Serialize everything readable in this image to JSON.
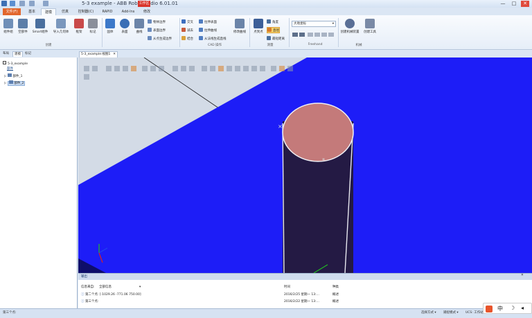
{
  "window": {
    "title": "5-3 example - ABB RobotStudio 6.01.01",
    "context_tab": "工作区",
    "controls": [
      "—",
      "□",
      "✕"
    ]
  },
  "tabs": [
    "文件(F)",
    "基本",
    "建模",
    "仿真",
    "控制器(C)",
    "RAPID",
    "Add-Ins",
    "修改"
  ],
  "ribbon": {
    "groups": [
      {
        "label": "创建",
        "large": [
          "组件组",
          "空部件",
          "Smart组件",
          "导入几何体",
          "框架",
          "标记"
        ]
      },
      {
        "label": "",
        "large": [
          "固体",
          "表面",
          "曲线"
        ],
        "small": [
          "物体边界",
          "表面边界",
          "从点生成边界"
        ]
      },
      {
        "label": "CAD 操作",
        "small": [
          "交叉",
          "减去",
          "结合",
          "拉伸表面",
          "拉伸曲线",
          "从法线生成直线"
        ],
        "large": [
          "修改曲线"
        ]
      },
      {
        "label": "测量",
        "large": [
          "点到点"
        ],
        "small": [
          "角度",
          "直径",
          "最短距离"
        ]
      },
      {
        "label": "Freehand",
        "select": "大地坐标"
      },
      {
        "label": "机械",
        "large": [
          "创建机械装置",
          "创建工具"
        ]
      }
    ]
  },
  "left_panel": {
    "tabs": [
      "布局",
      "建模",
      "标记"
    ],
    "section_label": "部件",
    "tree": {
      "station": "5-3_example",
      "items": [
        "部件_1",
        "部件_2"
      ]
    }
  },
  "viewport": {
    "tab_label": "5-3_example:视图1",
    "colors": {
      "floor": "#1d1df7",
      "bg": "#d3dbe6",
      "cylinder_body": "#241a44",
      "cylinder_top": "#c47a7a"
    }
  },
  "output": {
    "header": "输出",
    "columns": [
      "信息来自:",
      "全部信息",
      "时间",
      "种类"
    ],
    "rows": [
      {
        "msg": "第二个点: [-1029.26 -771.06 750.00]",
        "time": "2016/2/25 星期一 13:...",
        "kind": "概述"
      },
      {
        "msg": "第三个点:",
        "time": "2016/2/22 星期一 13:...",
        "kind": "概述"
      }
    ]
  },
  "status": {
    "left": "第三个点:",
    "select_mode": "选择方式 ▾",
    "snap_mode": "捕捉模式 ▾",
    "ucs": "UCS: 工作站"
  },
  "ime": [
    "中",
    "☽",
    "◂"
  ]
}
